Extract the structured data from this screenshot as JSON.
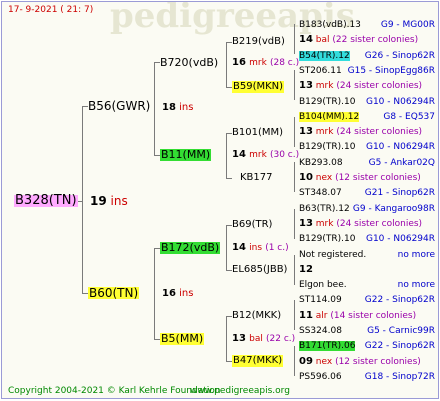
{
  "header": {
    "date": "17-  9-2021 (  21:  7)"
  },
  "watermark": "pedigreeapis",
  "root": {
    "label": "B328(TN)"
  },
  "generations": {
    "g1": {
      "num": "19",
      "ins": "ins"
    },
    "g2_top": {
      "num": "18",
      "ins": "ins"
    },
    "g2_bot": {
      "num": "16",
      "ins": "ins"
    },
    "g3_a": {
      "num": "16",
      "ins": "mrk",
      "extra": "(28 c.)"
    },
    "g3_b": {
      "num": "14",
      "ins": "mrk",
      "extra": "(30 c.)"
    },
    "g3_c": {
      "num": "14",
      "ins": "ins",
      "extra": "(1 c.)"
    },
    "g3_d": {
      "num": "13",
      "ins": "bal",
      "extra": "(22 c.)"
    }
  },
  "queens": {
    "q_b56": "B56(GWR)",
    "q_b60": "B60(TN)",
    "q_b720": "B720(vdB)",
    "q_b11": "B11(MM)",
    "q_b172": "B172(vdB)",
    "q_b5": "B5(MM)",
    "q_b219": "B219(vdB)",
    "q_b59": "B59(MKN)",
    "q_b101": "B101(MM)",
    "q_kb177": "KB177",
    "q_b69": "B69(TR)",
    "q_el685": "EL685(JBB)",
    "q_b12": "B12(MKK)",
    "q_b47": "B47(MKK)"
  },
  "right_entries": [
    {
      "name": "B183(vdB).13",
      "idx": "G9 - MG00R",
      "hl": ""
    },
    {
      "num": "14",
      "ins": "bal",
      "tail": "(22 sister colonies)"
    },
    {
      "name": "B54(TR).12",
      "idx": "G26 - Sinop62R",
      "hl": "cyan"
    },
    {
      "name": "ST206.11",
      "idx": "G15 - SinopEgg86R",
      "hl": ""
    },
    {
      "num": "13",
      "ins": "mrk",
      "tail": "(24 sister colonies)"
    },
    {
      "name": "B129(TR).10",
      "idx": "G10 - N06294R",
      "hl": ""
    },
    {
      "name": "B104(MM).12",
      "idx": "G8 - EQ537",
      "hl": "yellow"
    },
    {
      "num": "13",
      "ins": "mrk",
      "tail": "(24 sister colonies)"
    },
    {
      "name": "B129(TR).10",
      "idx": "G10 - N06294R",
      "hl": ""
    },
    {
      "name": "KB293.08",
      "idx": "G5 - Ankar02Q",
      "hl": ""
    },
    {
      "num": "10",
      "ins": "nex",
      "tail": "(12 sister colonies)"
    },
    {
      "name": "ST348.07",
      "idx": "G21 - Sinop62R",
      "hl": ""
    },
    {
      "name": "B63(TR).12",
      "idx": "G9 - Kangaroo98R",
      "hl": ""
    },
    {
      "num": "13",
      "ins": "mrk",
      "tail": "(24 sister colonies)"
    },
    {
      "name": "B129(TR).10",
      "idx": "G10 - N06294R",
      "hl": ""
    },
    {
      "name": "Not registered.",
      "idx": "no more",
      "hl": ""
    },
    {
      "num": "12",
      "ins": "",
      "tail": ""
    },
    {
      "name": "Elgon bee.",
      "idx": "no more",
      "hl": ""
    },
    {
      "name": "ST114.09",
      "idx": "G22 - Sinop62R",
      "hl": ""
    },
    {
      "num": "11",
      "ins": "alr",
      "tail": "(14 sister colonies)"
    },
    {
      "name": "SS324.08",
      "idx": "G5 - Carnic99R",
      "hl": ""
    },
    {
      "name": "B171(TR).06",
      "idx": "G22 - Sinop62R",
      "hl": "green"
    },
    {
      "num": "09",
      "ins": "nex",
      "tail": "(12 sister colonies)"
    },
    {
      "name": "PS596.06",
      "idx": "G18 - Sinop72R",
      "hl": ""
    }
  ],
  "footer": {
    "copyright": "Copyright 2004-2021 © Karl Kehrle Foundation",
    "site": "www.pedigreeapis.org"
  }
}
